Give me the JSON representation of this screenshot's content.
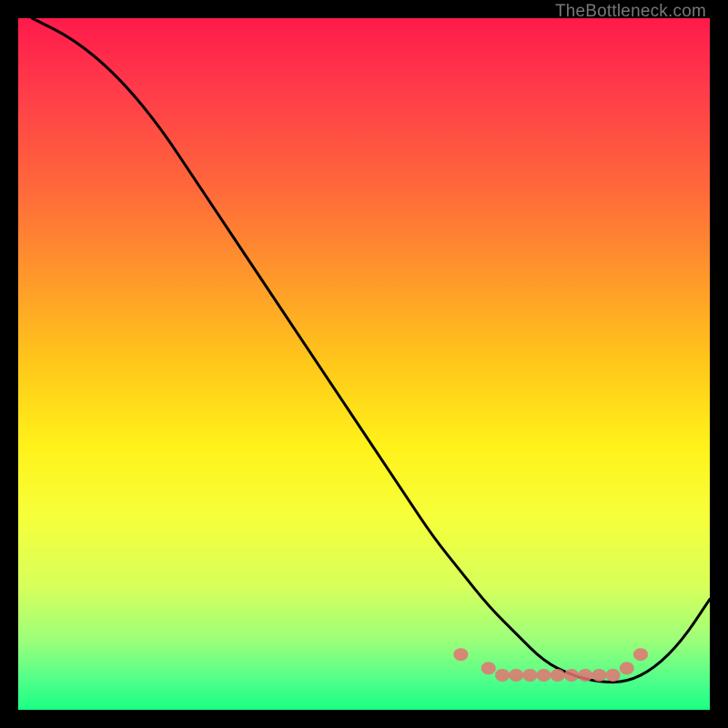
{
  "watermark": "TheBottleneck.com",
  "chart_data": {
    "type": "line",
    "title": "",
    "xlabel": "",
    "ylabel": "",
    "xlim": [
      0,
      100
    ],
    "ylim": [
      0,
      100
    ],
    "grid": false,
    "legend": false,
    "series": [
      {
        "name": "curve",
        "color": "#000000",
        "x": [
          2,
          8,
          14,
          20,
          26,
          32,
          38,
          44,
          50,
          56,
          60,
          64,
          68,
          72,
          76,
          80,
          84,
          88,
          92,
          96,
          100
        ],
        "y": [
          100,
          97,
          92,
          85,
          76,
          67,
          58,
          49,
          40,
          31,
          25,
          20,
          15,
          11,
          7,
          5,
          4,
          4,
          6,
          10,
          16
        ]
      }
    ],
    "markers": {
      "name": "dots",
      "color": "#e57373",
      "points": [
        {
          "x": 64,
          "y": 8
        },
        {
          "x": 68,
          "y": 6
        },
        {
          "x": 70,
          "y": 5
        },
        {
          "x": 72,
          "y": 5
        },
        {
          "x": 74,
          "y": 5
        },
        {
          "x": 76,
          "y": 5
        },
        {
          "x": 78,
          "y": 5
        },
        {
          "x": 80,
          "y": 5
        },
        {
          "x": 82,
          "y": 5
        },
        {
          "x": 84,
          "y": 5
        },
        {
          "x": 86,
          "y": 5
        },
        {
          "x": 88,
          "y": 6
        },
        {
          "x": 90,
          "y": 8
        }
      ]
    },
    "background_gradient": {
      "type": "vertical",
      "stops": [
        {
          "pos": 0,
          "color": "#ff1a4b"
        },
        {
          "pos": 50,
          "color": "#ffe61a"
        },
        {
          "pos": 100,
          "color": "#1aff84"
        }
      ]
    }
  }
}
